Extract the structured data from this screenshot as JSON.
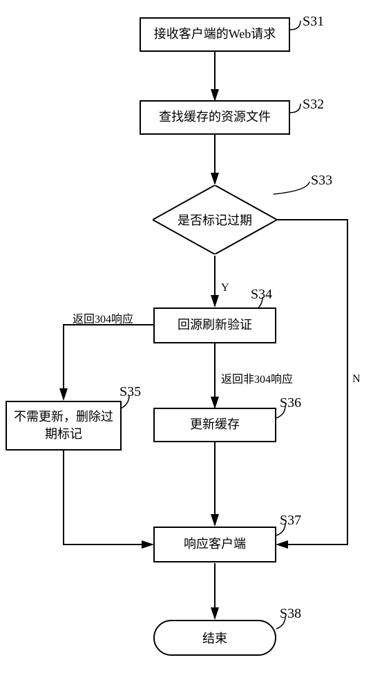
{
  "nodes": {
    "s31": {
      "text": "接收客户端的Web请求",
      "tag": "S31"
    },
    "s32": {
      "text": "查找缓存的资源文件",
      "tag": "S32"
    },
    "s33": {
      "text": "是否标记过期",
      "tag": "S33"
    },
    "s34": {
      "text": "回源刷新验证",
      "tag": "S34"
    },
    "s35": {
      "text": "不需更新，删除过期标记",
      "tag": "S35"
    },
    "s36": {
      "text": "更新缓存",
      "tag": "S36"
    },
    "s37": {
      "text": "响应客户端",
      "tag": "S37"
    },
    "s38": {
      "text": "结束",
      "tag": "S38"
    }
  },
  "edges": {
    "s33_yes": "Y",
    "s33_no": "N",
    "s34_left": "返回304响应",
    "s34_down": "返回非304响应"
  },
  "chart_data": {
    "type": "flowchart",
    "title": "",
    "nodes": [
      {
        "id": "S31",
        "type": "process",
        "label": "接收客户端的Web请求"
      },
      {
        "id": "S32",
        "type": "process",
        "label": "查找缓存的资源文件"
      },
      {
        "id": "S33",
        "type": "decision",
        "label": "是否标记过期"
      },
      {
        "id": "S34",
        "type": "process",
        "label": "回源刷新验证"
      },
      {
        "id": "S35",
        "type": "process",
        "label": "不需更新，删除过期标记"
      },
      {
        "id": "S36",
        "type": "process",
        "label": "更新缓存"
      },
      {
        "id": "S37",
        "type": "process",
        "label": "响应客户端"
      },
      {
        "id": "S38",
        "type": "terminator",
        "label": "结束"
      }
    ],
    "edges": [
      {
        "from": "S31",
        "to": "S32"
      },
      {
        "from": "S32",
        "to": "S33"
      },
      {
        "from": "S33",
        "to": "S34",
        "label": "Y"
      },
      {
        "from": "S33",
        "to": "S37",
        "label": "N"
      },
      {
        "from": "S34",
        "to": "S35",
        "label": "返回304响应"
      },
      {
        "from": "S34",
        "to": "S36",
        "label": "返回非304响应"
      },
      {
        "from": "S35",
        "to": "S37"
      },
      {
        "from": "S36",
        "to": "S37"
      },
      {
        "from": "S37",
        "to": "S38"
      }
    ]
  }
}
